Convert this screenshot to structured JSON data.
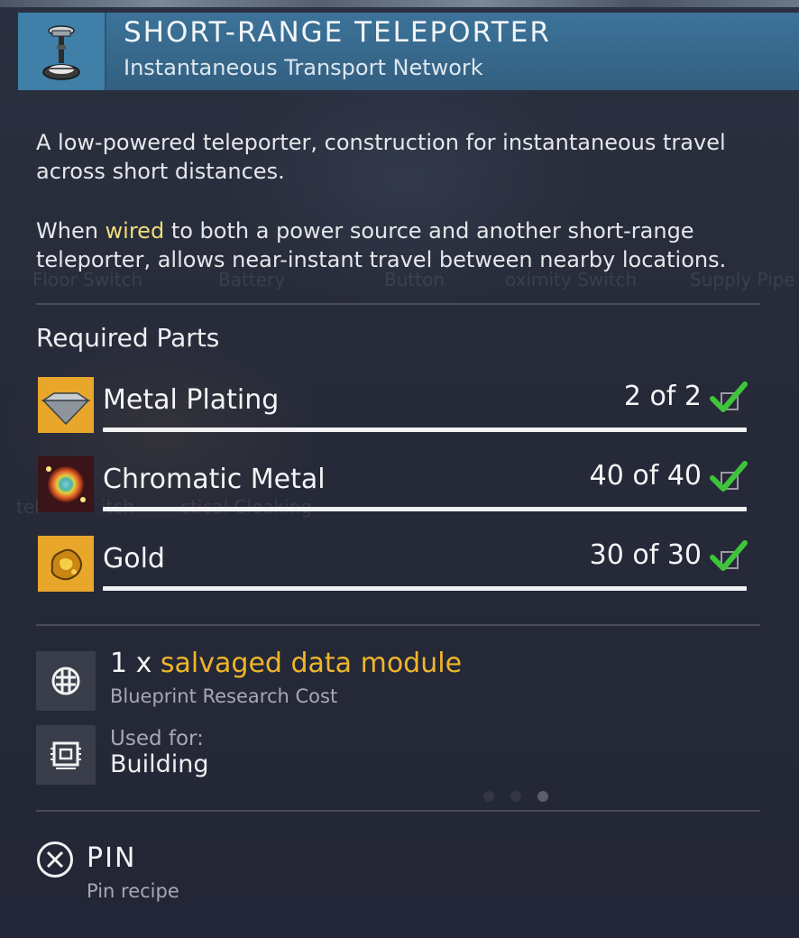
{
  "header": {
    "title": "SHORT-RANGE TELEPORTER",
    "subtitle": "Instantaneous Transport Network",
    "icon": "teleporter-icon"
  },
  "description": {
    "para1": "A low-powered teleporter, construction for instantaneous travel across short distances.",
    "para2_before": "When ",
    "para2_highlight": "wired",
    "para2_after": " to both a power source and another short-range teleporter, allows near-instant travel between nearby locations."
  },
  "required_parts": {
    "title": "Required Parts",
    "items": [
      {
        "name": "Metal Plating",
        "count": "2 of 2",
        "icon": "metal-plating-icon",
        "icon_bg": "#e8a62a",
        "complete": true
      },
      {
        "name": "Chromatic Metal",
        "count": "40 of 40",
        "icon": "chromatic-metal-icon",
        "icon_bg": "#3a1418",
        "complete": true
      },
      {
        "name": "Gold",
        "count": "30 of 30",
        "icon": "gold-icon",
        "icon_bg": "#e8a62a",
        "complete": true
      }
    ]
  },
  "research_cost": {
    "quantity": "1 x ",
    "item": "salvaged data module",
    "label": "Blueprint Research Cost",
    "icon": "data-module-icon"
  },
  "used_for": {
    "label": "Used for:",
    "value": "Building",
    "icon": "building-chip-icon"
  },
  "pin": {
    "label": "PIN",
    "sub": "Pin recipe",
    "icon": "x-button-icon"
  },
  "background_labels": [
    "Floor Switch",
    "Battery",
    "Button",
    "oximity Switch",
    "Supply Pipe",
    "tel",
    "itch",
    "ctical Cloaking"
  ],
  "colors": {
    "header_bg": "#3c7399",
    "highlight": "#f0dd7a",
    "gold_text": "#f0b52a",
    "check_green": "#3ec43a"
  }
}
